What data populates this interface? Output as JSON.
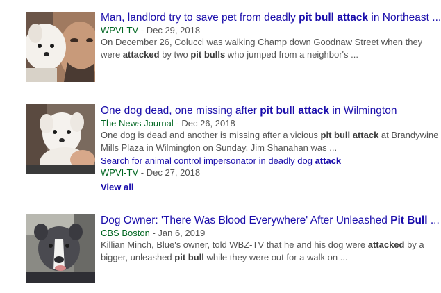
{
  "results": [
    {
      "headline": [
        "Man, landlord try to save pet from deadly ",
        "pit bull attack",
        " in Northeast ..."
      ],
      "source": "WPVI-TV",
      "date": " - Dec 29, 2018",
      "snippet": [
        "On December 26, Colucci was walking Champ down Goodnaw Street when they were ",
        "attacked",
        " by two ",
        "pit bulls",
        " who jumped from a neighbor's ..."
      ],
      "thumb_icon": "dog-and-man-photo"
    },
    {
      "headline": [
        "One dog dead, one missing after ",
        "pit bull attack",
        " in Wilmington"
      ],
      "source": "The News Journal",
      "date": " - Dec 26, 2018",
      "snippet": [
        "One dog is dead and another is missing after a vicious ",
        "pit bull attack",
        " at Brandywine Mills Plaza in Wilmington on Sunday. Jim Shanahan was ..."
      ],
      "sub_link": [
        "Search for animal control impersonator in deadly dog ",
        "attack"
      ],
      "sub_source": "WPVI-TV",
      "sub_date": " - Dec 27, 2018",
      "view_all": "View all",
      "thumb_icon": "white-dog-photo"
    },
    {
      "headline": [
        "Dog Owner: 'There Was Blood Everywhere' After Unleashed ",
        "Pit Bull",
        " ..."
      ],
      "source": "CBS Boston",
      "date": " - Jan 6, 2019",
      "snippet": [
        "Killian Minch, Blue's owner, told WBZ-TV that he and his dog were ",
        "attacked",
        " by a bigger, unleashed ",
        "pit bull",
        " while they were out for a walk on ..."
      ],
      "thumb_icon": "pit-bull-photo"
    }
  ],
  "colors": {
    "link": "#1a0dab",
    "source": "#006621",
    "snippet": "#545454"
  }
}
